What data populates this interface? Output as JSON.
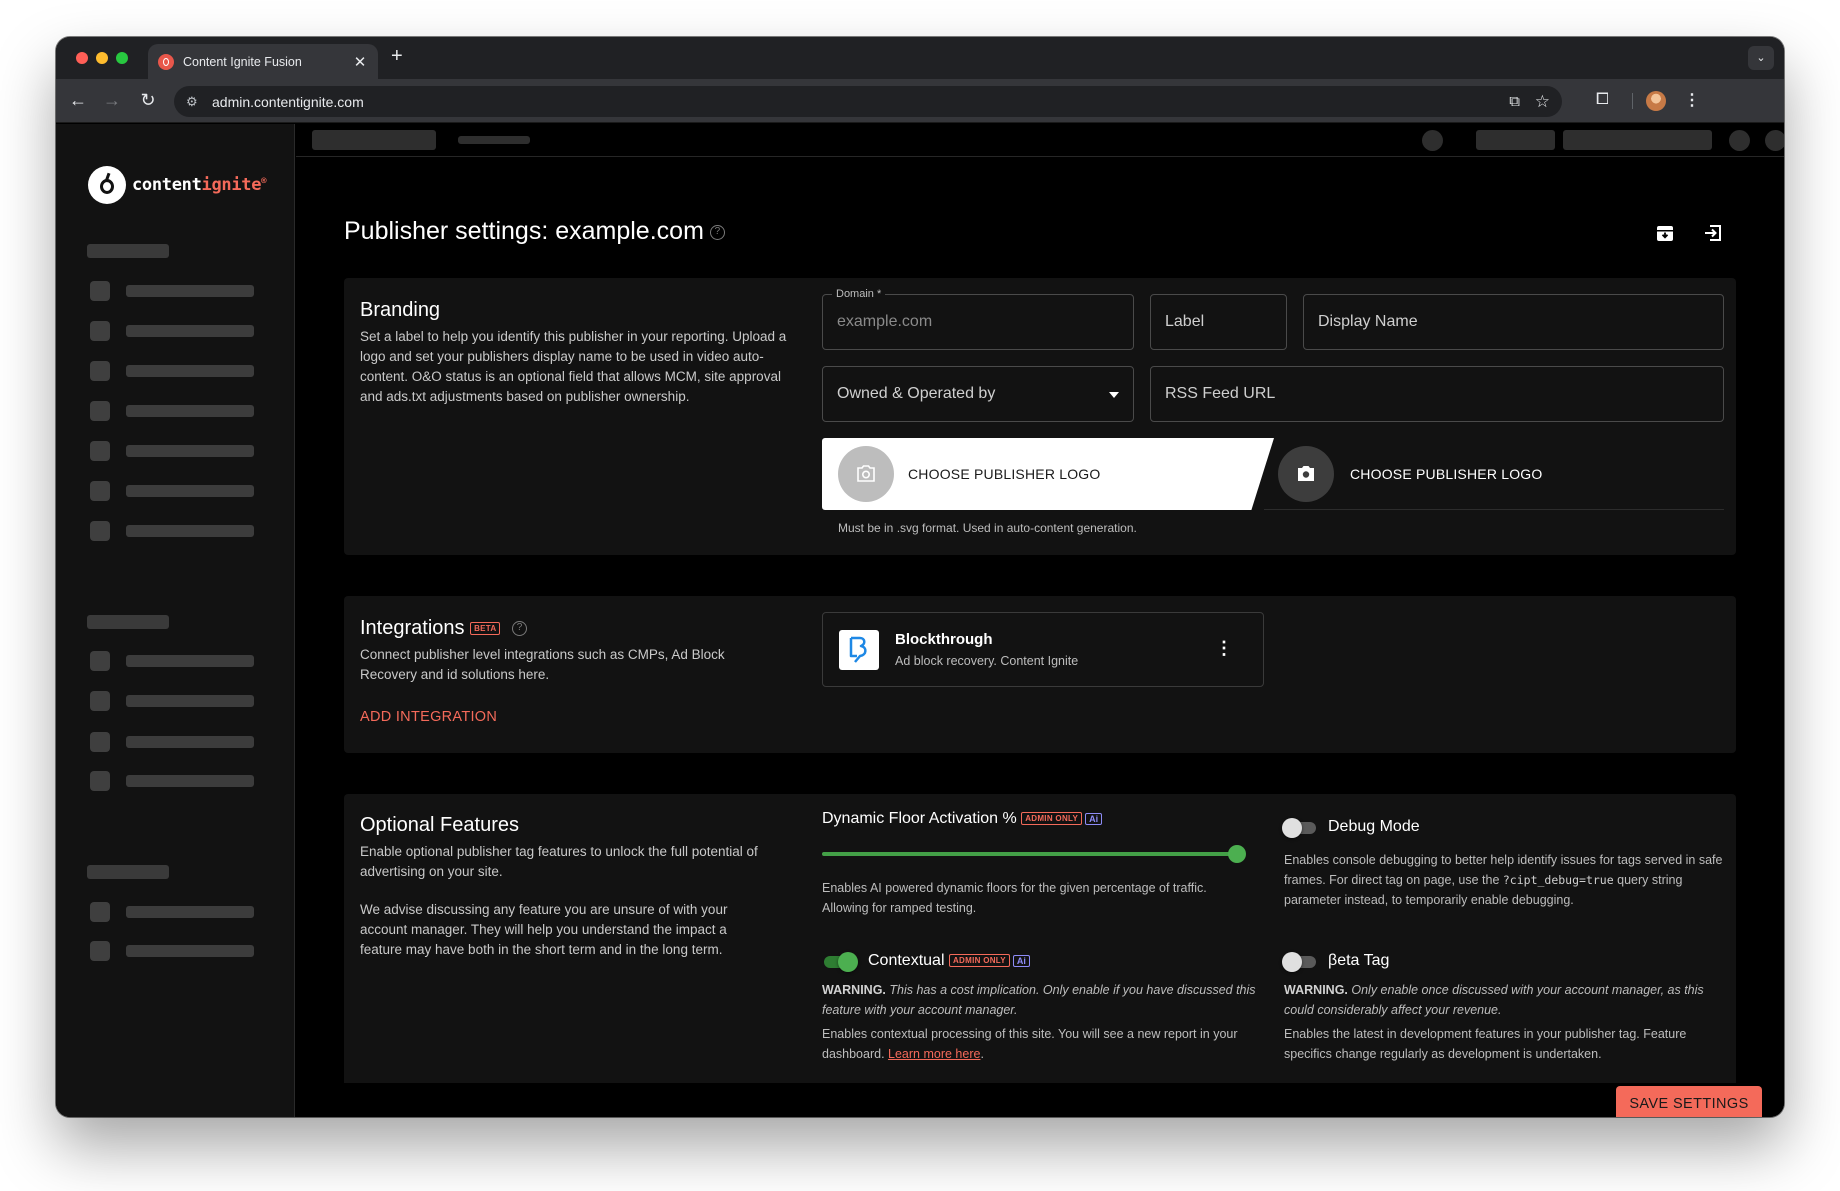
{
  "browser": {
    "tab_title": "Content Ignite Fusion",
    "url": "admin.contentignite.com"
  },
  "sidebar": {
    "logo_text_a": "content",
    "logo_text_b": "ignite",
    "logo_reg": "®"
  },
  "page": {
    "title": "Publisher settings: example.com",
    "help_glyph": "?"
  },
  "branding": {
    "title": "Branding",
    "description": "Set a label to help you identify this publisher in your reporting. Upload a logo and set your publishers display name to be used in video auto-content. O&O status is an optional field that allows MCM, site approval and ads.txt adjustments based on publisher ownership.",
    "domain_label": "Domain *",
    "domain_placeholder": "example.com",
    "label_placeholder": "Label",
    "display_name_placeholder": "Display Name",
    "owned_select": "Owned & Operated by",
    "rss_placeholder": "RSS Feed URL",
    "choose_logo_light": "CHOOSE PUBLISHER LOGO",
    "choose_logo_dark": "CHOOSE PUBLISHER LOGO",
    "logo_helper": "Must be in .svg format. Used in auto-content generation."
  },
  "integrations": {
    "title": "Integrations",
    "beta_badge": "BETA",
    "description": "Connect publisher level integrations such as CMPs, Ad Block Recovery and id solutions here.",
    "add_label": "ADD INTEGRATION",
    "items": [
      {
        "name": "Blockthrough",
        "subtitle": "Ad block recovery. Content Ignite"
      }
    ]
  },
  "optional_features": {
    "title": "Optional Features",
    "description_1": "Enable optional publisher tag features to unlock the full potential of advertising on your site.",
    "description_2": "We advise discussing any feature you are unsure of with your account manager. They will help you understand the impact a feature may have both in the short term and in the long term.",
    "dynamic_floor": {
      "label": "Dynamic Floor Activation %",
      "admin_badge": "ADMIN ONLY",
      "ai_badge": "Ai",
      "value_percent": 100,
      "description": "Enables AI powered dynamic floors for the given percentage of traffic. Allowing for ramped testing."
    },
    "debug_mode": {
      "label": "Debug Mode",
      "enabled": false,
      "description_a": "Enables console debugging to better help identify issues for tags served in safe frames. For direct tag on page, use the ",
      "code": "?cipt_debug=true",
      "description_b": " query string parameter instead, to temporarily enable debugging."
    },
    "contextual": {
      "label": "Contextual",
      "admin_badge": "ADMIN ONLY",
      "ai_badge": "Ai",
      "enabled": true,
      "warning_prefix": "WARNING.",
      "warning_text": " This has a cost implication. Only enable if you have discussed this feature with your account manager.",
      "description": "Enables contextual processing of this site. You will see a new report in your dashboard. ",
      "link": "Learn more here",
      "link_suffix": "."
    },
    "beta_tag": {
      "label": "βeta Tag",
      "enabled": false,
      "warning_prefix": "WARNING.",
      "warning_text": " Only enable once discussed with your account manager, as this could considerably affect your revenue.",
      "description": "Enables the latest in development features in your publisher tag. Feature specifics change regularly as development is undertaken."
    }
  },
  "footer": {
    "save_label": "SAVE SETTINGS"
  },
  "colors": {
    "accent": "#f46a5a",
    "success": "#4caf50",
    "background": "#000000",
    "card": "#121212"
  }
}
